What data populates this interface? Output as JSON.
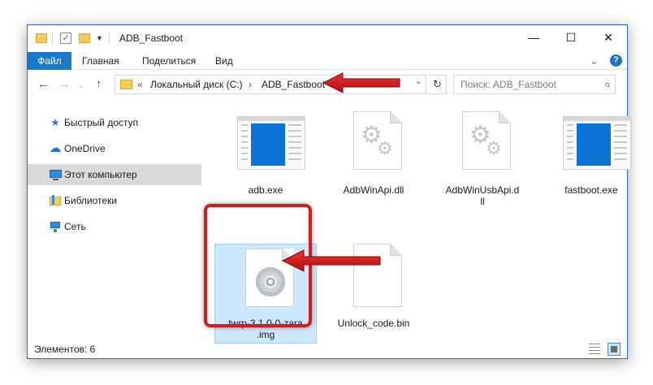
{
  "window": {
    "title": "ADB_Fastboot",
    "controls": {
      "minimize": "—",
      "maximize": "☐",
      "close": "✕"
    }
  },
  "ribbon": {
    "tabs": [
      "Файл",
      "Главная",
      "Поделиться",
      "Вид"
    ],
    "help": "?"
  },
  "address": {
    "prefix": "«",
    "crumbs": [
      "Локальный диск (C:)",
      "ADB_Fastboot"
    ],
    "separator": "›"
  },
  "search": {
    "placeholder": "Поиск: ADB_Fastboot"
  },
  "sidebar": {
    "items": [
      {
        "label": "Быстрый доступ",
        "icon": "star-icon"
      },
      {
        "label": "OneDrive",
        "icon": "cloud-icon"
      },
      {
        "label": "Этот компьютер",
        "icon": "computer-icon",
        "selected": true
      },
      {
        "label": "Библиотеки",
        "icon": "library-icon"
      },
      {
        "label": "Сеть",
        "icon": "network-icon"
      }
    ]
  },
  "files": [
    {
      "name": "adb.exe",
      "icon": "exe-icon"
    },
    {
      "name": "AdbWinApi.dll",
      "icon": "dll-icon"
    },
    {
      "name_line1": "AdbWinUsbApi.d",
      "name_line2": "ll",
      "icon": "dll-icon"
    },
    {
      "name": "fastboot.exe",
      "icon": "exe-icon"
    },
    {
      "name_line1": "twrp-3.1.0-0-zara",
      "name_line2": ".img",
      "icon": "disc-image-icon",
      "selected": true
    },
    {
      "name": "Unlock_code.bin",
      "icon": "blank-file-icon"
    }
  ],
  "status": {
    "items_label": "Элементов: 6"
  },
  "colors": {
    "accent": "#1979ca",
    "annotation_red": "#d51b1b",
    "selection": "#cce8ff"
  }
}
